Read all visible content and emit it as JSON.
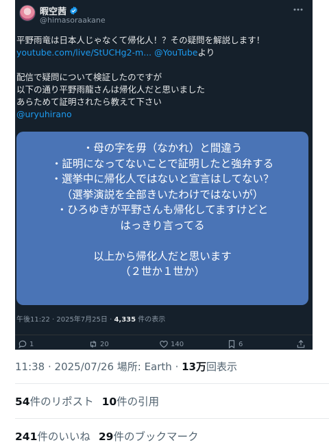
{
  "tweet": {
    "display_name": "暇空茜",
    "handle": "@himasoraakane",
    "body_line1": "平野雨竜は日本人じゃなくて帰化人！？その疑問を解説します！",
    "link_text": "youtube.com/live/StUCHg2-m...",
    "mention_youtube": "@YouTube",
    "body_yori": "より",
    "body_line4": "配信で疑問について検証したのですが",
    "body_line5": "以下の通り平野雨龍さんは帰化人だと思いました",
    "body_line6": "あらためて証明されたら教えて下さい",
    "mention_uryu": "@uryuhirano",
    "image_text": [
      "・母の字を毋（なかれ）と間違う",
      "・証明になってないことで証明したと強弁する",
      "・選挙中に帰化人ではないと宣言はしてない？",
      "（選挙演説を全部きいたわけではないが）",
      "・ひろゆきが平野さんも帰化してますけどと",
      "はっきり言ってる",
      "以上から帰化人だと思います",
      "（２世か１世か）"
    ],
    "timestamp_prefix": "午後11:22 · 2025年7月25日 · ",
    "timestamp_views": "4,335",
    "timestamp_suffix": " 件の表示",
    "actions": {
      "reply_count": "1",
      "retweet_count": "20",
      "like_count": "140",
      "bookmark_count": "6"
    }
  },
  "post_meta": {
    "text_prefix": "11:38 · 2025/07/26 場所: Earth · ",
    "views_value": "13万",
    "views_suffix": "回表示"
  },
  "stats": {
    "reposts_value": "54",
    "reposts_label": "件のリポスト",
    "quotes_value": "10",
    "quotes_label": "件の引用",
    "likes_value": "241",
    "likes_label": "件のいいね",
    "bookmarks_value": "29",
    "bookmarks_label": "件のブックマーク"
  },
  "colors": {
    "card_bg": "#15202b",
    "image_bg": "#4a74b6",
    "link": "#1d9bf0",
    "verified": "#1d9bf0"
  }
}
